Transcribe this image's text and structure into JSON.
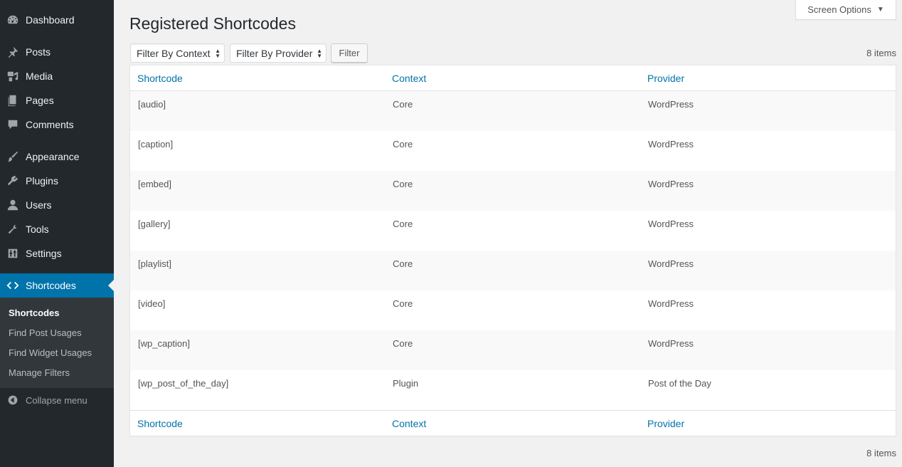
{
  "sidebar": {
    "menu": [
      {
        "label": "Dashboard",
        "icon": "dashboard-icon"
      },
      {
        "label": "Posts",
        "icon": "pushpin-icon"
      },
      {
        "label": "Media",
        "icon": "media-icon"
      },
      {
        "label": "Pages",
        "icon": "pages-icon"
      },
      {
        "label": "Comments",
        "icon": "comment-icon"
      },
      {
        "label": "Appearance",
        "icon": "paintbrush-icon"
      },
      {
        "label": "Plugins",
        "icon": "plugin-icon"
      },
      {
        "label": "Users",
        "icon": "user-icon"
      },
      {
        "label": "Tools",
        "icon": "wrench-icon"
      },
      {
        "label": "Settings",
        "icon": "settings-icon"
      },
      {
        "label": "Shortcodes",
        "icon": "code-icon"
      }
    ],
    "submenu": [
      "Shortcodes",
      "Find Post Usages",
      "Find Widget Usages",
      "Manage Filters"
    ],
    "collapse_label": "Collapse menu"
  },
  "header": {
    "title": "Registered Shortcodes",
    "screen_options": "Screen Options"
  },
  "filters": {
    "context_select": "Filter By Context",
    "provider_select": "Filter By Provider",
    "filter_button": "Filter",
    "items_count": "8 items"
  },
  "table": {
    "columns": [
      "Shortcode",
      "Context",
      "Provider"
    ],
    "rows": [
      [
        "[audio]",
        "Core",
        "WordPress"
      ],
      [
        "[caption]",
        "Core",
        "WordPress"
      ],
      [
        "[embed]",
        "Core",
        "WordPress"
      ],
      [
        "[gallery]",
        "Core",
        "WordPress"
      ],
      [
        "[playlist]",
        "Core",
        "WordPress"
      ],
      [
        "[video]",
        "Core",
        "WordPress"
      ],
      [
        "[wp_caption]",
        "Core",
        "WordPress"
      ],
      [
        "[wp_post_of_the_day]",
        "Plugin",
        "Post of the Day"
      ]
    ]
  },
  "colors": {
    "sidebar_bg": "#23282d",
    "submenu_bg": "#32373c",
    "accent": "#0073aa",
    "page_bg": "#f1f1f1"
  }
}
